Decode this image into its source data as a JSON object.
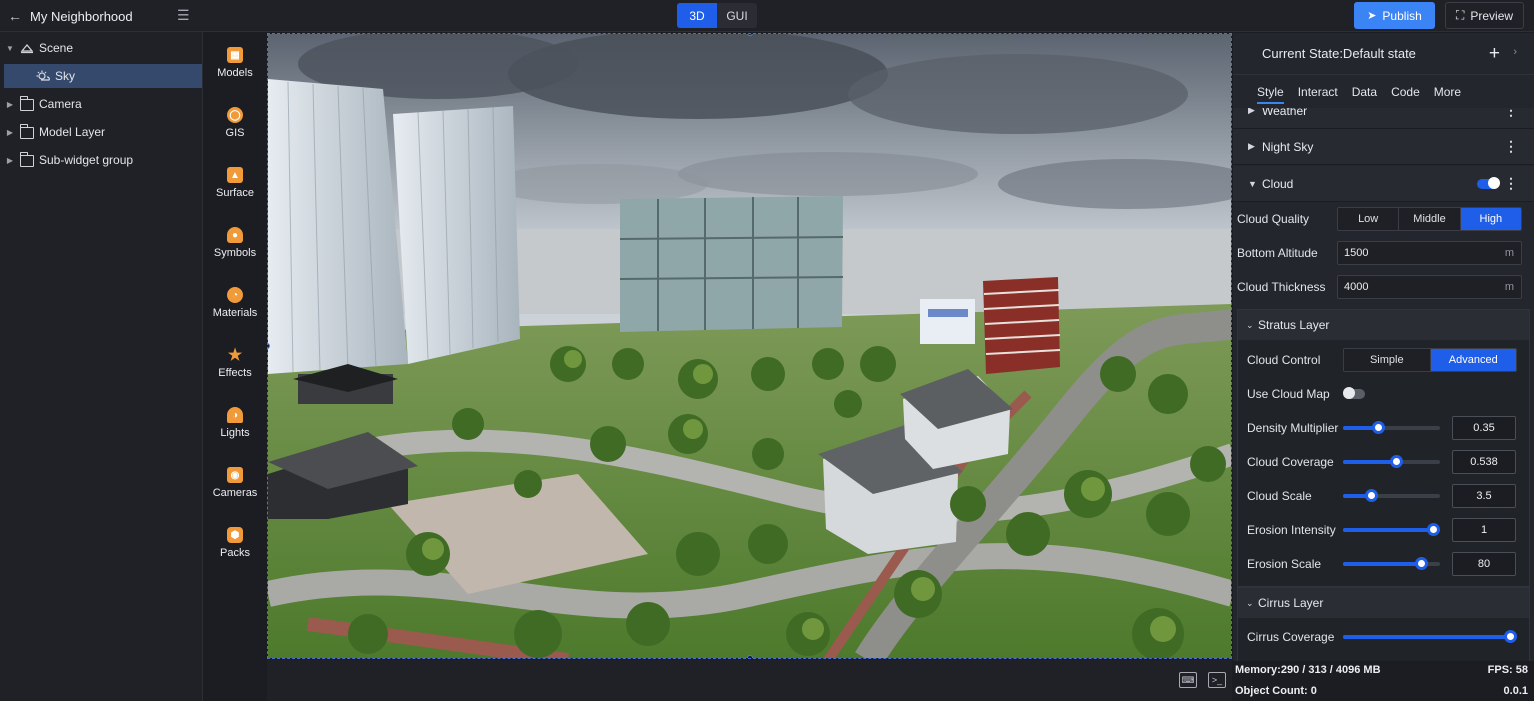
{
  "header": {
    "project_title": "My Neighborhood",
    "mode_tabs": [
      "3D",
      "GUI"
    ],
    "active_mode": "3D",
    "publish_label": "Publish",
    "preview_label": "Preview",
    "accent_color": "#3b84f6"
  },
  "tree": {
    "items": [
      {
        "label": "Scene",
        "icon": "scene-icon",
        "expanded": true
      },
      {
        "label": "Sky",
        "icon": "sky-icon",
        "selected": true
      },
      {
        "label": "Camera",
        "icon": "folder-icon"
      },
      {
        "label": "Model Layer",
        "icon": "folder-icon"
      },
      {
        "label": "Sub-widget group",
        "icon": "folder-icon"
      }
    ]
  },
  "widgets": [
    {
      "label": "Models",
      "icon": "models-icon"
    },
    {
      "label": "GIS",
      "icon": "gis-icon"
    },
    {
      "label": "Surface",
      "icon": "surface-icon"
    },
    {
      "label": "Symbols",
      "icon": "symbols-icon"
    },
    {
      "label": "Materials",
      "icon": "materials-icon"
    },
    {
      "label": "Effects",
      "icon": "effects-icon"
    },
    {
      "label": "Lights",
      "icon": "lights-icon"
    },
    {
      "label": "Cameras",
      "icon": "cameras-icon"
    },
    {
      "label": "Packs",
      "icon": "packs-icon"
    }
  ],
  "panel": {
    "current_state": "Current State:Default state",
    "tabs": [
      "Style",
      "Interact",
      "Data",
      "Code",
      "More"
    ],
    "active_tab": "Style",
    "sections": {
      "weather": "Weather",
      "night_sky": "Night Sky",
      "cloud": "Cloud"
    },
    "cloud_enabled": true,
    "cloud_quality": {
      "label": "Cloud Quality",
      "options": [
        "Low",
        "Middle",
        "High"
      ],
      "selected": "High"
    },
    "bottom_altitude": {
      "label": "Bottom Altitude",
      "value": "1500",
      "unit": "m"
    },
    "cloud_thickness": {
      "label": "Cloud Thickness",
      "value": "4000",
      "unit": "m"
    },
    "stratus": {
      "title": "Stratus Layer",
      "cloud_control": {
        "label": "Cloud Control",
        "options": [
          "Simple",
          "Advanced"
        ],
        "selected": "Advanced"
      },
      "use_cloud_map": {
        "label": "Use Cloud Map",
        "enabled": false
      },
      "sliders": [
        {
          "label": "Density Multiplier",
          "value": "0.35",
          "fraction": 0.36
        },
        {
          "label": "Cloud Coverage",
          "value": "0.538",
          "fraction": 0.55
        },
        {
          "label": "Cloud Scale",
          "value": "3.5",
          "fraction": 0.29
        },
        {
          "label": "Erosion Intensity",
          "value": "1",
          "fraction": 1.0
        },
        {
          "label": "Erosion Scale",
          "value": "80",
          "fraction": 0.8
        }
      ]
    },
    "cirrus": {
      "title": "Cirrus Layer",
      "coverage_label": "Cirrus Coverage",
      "coverage_fraction": 1.0
    }
  },
  "status": {
    "memory": "Memory:290 / 313 / 4096 MB",
    "fps": "FPS: 58",
    "object_count": "Object Count: 0",
    "version": "0.0.1"
  }
}
